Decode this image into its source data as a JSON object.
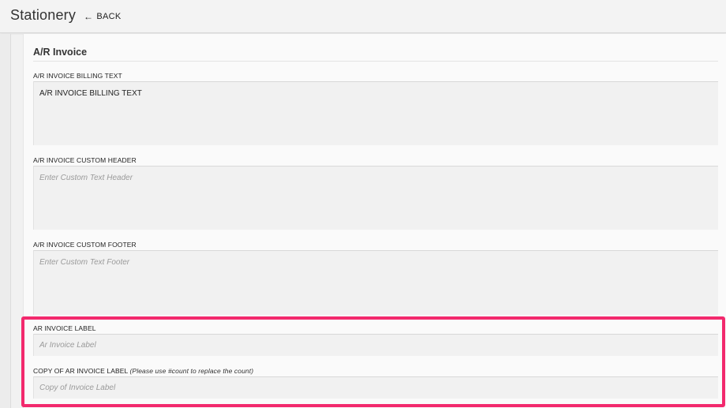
{
  "header": {
    "title": "Stationery",
    "back_label": "BACK",
    "back_icon": "arrow-left-icon"
  },
  "section": {
    "title": "A/R Invoice"
  },
  "fields": {
    "billing_text": {
      "label": "A/R INVOICE BILLING TEXT",
      "value": "A/R INVOICE BILLING TEXT"
    },
    "custom_header": {
      "label": "A/R INVOICE CUSTOM HEADER",
      "placeholder": "Enter Custom Text Header"
    },
    "custom_footer": {
      "label": "A/R INVOICE CUSTOM FOOTER",
      "placeholder": "Enter Custom Text Footer"
    },
    "ar_invoice_label": {
      "label": "AR INVOICE LABEL",
      "placeholder": "Ar Invoice Label"
    },
    "copy_label": {
      "label": "COPY OF AR INVOICE LABEL",
      "hint": "(Please use #count to replace the count)",
      "placeholder": "Copy of Invoice Label"
    }
  },
  "colors": {
    "highlight": "#f2296d",
    "field_bg": "#f1f1f1",
    "page_bg": "#fafafa"
  }
}
